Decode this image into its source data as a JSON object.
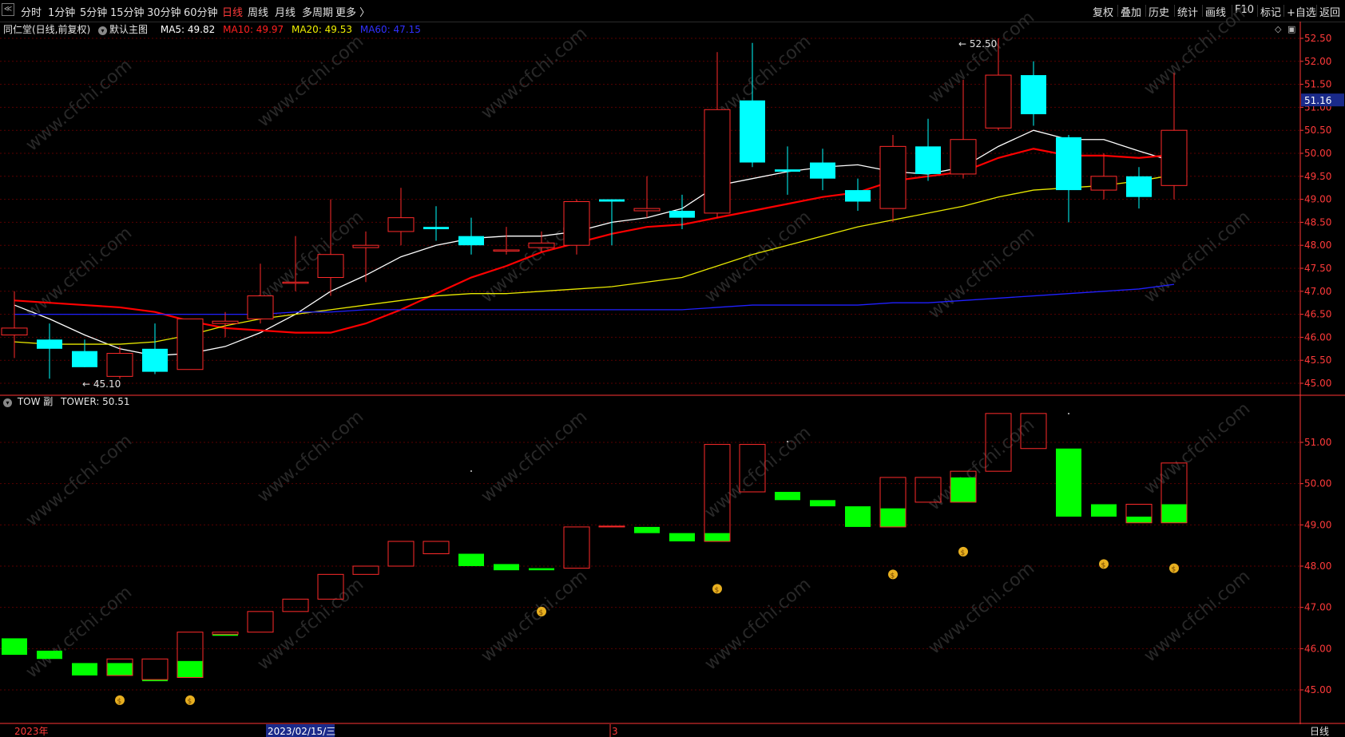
{
  "toolbar": {
    "left_icon": "collapse-icon",
    "periods": [
      "分时",
      "1分钟",
      "5分钟",
      "15分钟",
      "30分钟",
      "60分钟",
      "日线",
      "周线",
      "月线",
      "多周期",
      "更多 〉"
    ],
    "active_period": "日线",
    "right": [
      "复权",
      "叠加",
      "历史",
      "统计",
      "画线",
      "F10",
      "标记",
      "+自选",
      "返回"
    ]
  },
  "main_legend": {
    "stock": "同仁堂(日线,前复权)",
    "template": "默认主图",
    "ma5": "MA5: 49.82",
    "ma10": "MA10: 49.97",
    "ma20": "MA20: 49.53",
    "ma60": "MA60: 47.15"
  },
  "sub_legend": {
    "name": "TOW 副",
    "value": "TOWER: 50.51"
  },
  "annotations": {
    "high": "52.50",
    "low": "45.10",
    "last_price": "51.16"
  },
  "bottom": {
    "year": "2023年",
    "date": "2023/02/15/三",
    "month": "3",
    "period": "日线"
  },
  "watermark": "www.cfchi.com",
  "colors": {
    "up": "#ff2a2a",
    "down": "#00ffff",
    "ma5": "#ffffff",
    "ma10": "#ff0000",
    "ma20": "#e8e800",
    "ma60": "#2020ff",
    "tower_up": "#00ff00",
    "tower_frame": "#ff2a2a",
    "axis": "#ff3333",
    "grid": "#5a0000"
  },
  "chart_data": [
    {
      "type": "candlestick",
      "title": "同仁堂(日线,前复权)",
      "y_ticks": [
        "52.50",
        "52.00",
        "51.50",
        "51.00",
        "50.50",
        "50.00",
        "49.50",
        "49.00",
        "48.50",
        "48.00",
        "47.50",
        "47.00",
        "46.50",
        "46.00",
        "45.50",
        "45.00"
      ],
      "ylim": [
        44.9,
        52.6
      ],
      "candles": [
        {
          "o": 46.05,
          "h": 47.0,
          "l": 45.55,
          "c": 46.2
        },
        {
          "o": 45.95,
          "h": 46.3,
          "l": 45.1,
          "c": 45.75
        },
        {
          "o": 45.7,
          "h": 45.95,
          "l": 45.35,
          "c": 45.35
        },
        {
          "o": 45.15,
          "h": 45.8,
          "l": 45.1,
          "c": 45.65
        },
        {
          "o": 45.75,
          "h": 46.3,
          "l": 45.2,
          "c": 45.25
        },
        {
          "o": 45.3,
          "h": 46.4,
          "l": 45.3,
          "c": 46.4
        },
        {
          "o": 46.3,
          "h": 46.55,
          "l": 46.0,
          "c": 46.35
        },
        {
          "o": 46.4,
          "h": 47.6,
          "l": 46.3,
          "c": 46.9
        },
        {
          "o": 47.2,
          "h": 48.2,
          "l": 47.0,
          "c": 47.2
        },
        {
          "o": 47.3,
          "h": 49.0,
          "l": 46.9,
          "c": 47.8
        },
        {
          "o": 47.95,
          "h": 48.3,
          "l": 47.2,
          "c": 48.0
        },
        {
          "o": 48.3,
          "h": 49.25,
          "l": 48.0,
          "c": 48.6
        },
        {
          "o": 48.4,
          "h": 48.85,
          "l": 48.1,
          "c": 48.35
        },
        {
          "o": 48.2,
          "h": 48.6,
          "l": 47.8,
          "c": 48.0
        },
        {
          "o": 47.9,
          "h": 48.4,
          "l": 47.8,
          "c": 47.9
        },
        {
          "o": 47.95,
          "h": 48.3,
          "l": 47.85,
          "c": 48.05
        },
        {
          "o": 48.0,
          "h": 49.0,
          "l": 47.8,
          "c": 48.95
        },
        {
          "o": 49.0,
          "h": 49.0,
          "l": 48.0,
          "c": 48.95
        },
        {
          "o": 48.75,
          "h": 49.5,
          "l": 48.6,
          "c": 48.8
        },
        {
          "o": 48.75,
          "h": 49.1,
          "l": 48.35,
          "c": 48.6
        },
        {
          "o": 48.7,
          "h": 52.2,
          "l": 48.6,
          "c": 50.95
        },
        {
          "o": 51.15,
          "h": 52.4,
          "l": 49.7,
          "c": 49.8
        },
        {
          "o": 49.65,
          "h": 50.15,
          "l": 49.1,
          "c": 49.6
        },
        {
          "o": 49.8,
          "h": 50.1,
          "l": 49.2,
          "c": 49.45
        },
        {
          "o": 49.2,
          "h": 49.45,
          "l": 48.75,
          "c": 48.95
        },
        {
          "o": 48.8,
          "h": 50.4,
          "l": 48.5,
          "c": 50.15
        },
        {
          "o": 50.15,
          "h": 50.75,
          "l": 49.4,
          "c": 49.55
        },
        {
          "o": 49.55,
          "h": 51.6,
          "l": 49.45,
          "c": 50.3
        },
        {
          "o": 50.55,
          "h": 52.5,
          "l": 50.5,
          "c": 51.7
        },
        {
          "o": 51.7,
          "h": 52.0,
          "l": 50.6,
          "c": 50.85
        },
        {
          "o": 50.35,
          "h": 50.4,
          "l": 48.5,
          "c": 49.2
        },
        {
          "o": 49.2,
          "h": 50.0,
          "l": 49.0,
          "c": 49.5
        },
        {
          "o": 49.5,
          "h": 49.7,
          "l": 48.8,
          "c": 49.05
        },
        {
          "o": 49.3,
          "h": 51.75,
          "l": 49.0,
          "c": 50.5
        }
      ],
      "series": [
        {
          "name": "MA5",
          "values": [
            46.7,
            46.4,
            46.05,
            45.75,
            45.6,
            45.65,
            45.8,
            46.1,
            46.5,
            47.0,
            47.35,
            47.75,
            48.0,
            48.15,
            48.2,
            48.2,
            48.3,
            48.5,
            48.6,
            48.8,
            49.3,
            49.45,
            49.6,
            49.7,
            49.75,
            49.6,
            49.55,
            49.7,
            50.15,
            50.5,
            50.3,
            50.3,
            50.05,
            49.82
          ]
        },
        {
          "name": "MA10",
          "values": [
            46.8,
            46.75,
            46.7,
            46.65,
            46.55,
            46.35,
            46.2,
            46.15,
            46.1,
            46.1,
            46.3,
            46.6,
            46.95,
            47.3,
            47.55,
            47.85,
            48.05,
            48.25,
            48.4,
            48.45,
            48.6,
            48.75,
            48.9,
            49.05,
            49.15,
            49.4,
            49.5,
            49.6,
            49.9,
            50.1,
            49.95,
            49.95,
            49.9,
            49.97
          ]
        },
        {
          "name": "MA20",
          "values": [
            45.9,
            45.85,
            45.85,
            45.85,
            45.9,
            46.05,
            46.25,
            46.4,
            46.5,
            46.6,
            46.7,
            46.8,
            46.9,
            46.95,
            46.95,
            47.0,
            47.05,
            47.1,
            47.2,
            47.3,
            47.55,
            47.8,
            48.0,
            48.2,
            48.4,
            48.55,
            48.7,
            48.85,
            49.05,
            49.2,
            49.25,
            49.3,
            49.4,
            49.53
          ]
        },
        {
          "name": "MA60",
          "values": [
            46.5,
            46.5,
            46.5,
            46.5,
            46.5,
            46.5,
            46.5,
            46.5,
            46.55,
            46.55,
            46.6,
            46.6,
            46.6,
            46.6,
            46.6,
            46.6,
            46.6,
            46.6,
            46.6,
            46.6,
            46.65,
            46.7,
            46.7,
            46.7,
            46.7,
            46.75,
            46.75,
            46.8,
            46.85,
            46.9,
            46.95,
            47.0,
            47.05,
            47.15
          ]
        }
      ]
    },
    {
      "type": "bar",
      "title": "TOW 副 TOWER",
      "y_ticks": [
        "51.00",
        "50.00",
        "49.00",
        "48.00",
        "47.00",
        "46.00",
        "45.00"
      ],
      "ylim": [
        44.6,
        51.9
      ],
      "towers": [
        {
          "lo": 45.85,
          "hi": 46.25,
          "frame_lo": null,
          "frame_hi": null,
          "fill": "green"
        },
        {
          "lo": 45.75,
          "hi": 45.95,
          "frame_lo": null,
          "frame_hi": null,
          "fill": "green"
        },
        {
          "lo": 45.35,
          "hi": 45.65,
          "frame_lo": null,
          "frame_hi": null,
          "fill": "green"
        },
        {
          "lo": 45.35,
          "hi": 45.65,
          "frame_lo": 45.35,
          "frame_hi": 45.75,
          "fill": "green"
        },
        {
          "lo": 45.25,
          "hi": 45.25,
          "frame_lo": 45.25,
          "frame_hi": 45.75,
          "fill": "none"
        },
        {
          "lo": 45.3,
          "hi": 45.7,
          "frame_lo": 45.3,
          "frame_hi": 46.4,
          "fill": "green"
        },
        {
          "lo": 46.35,
          "hi": 46.35,
          "frame_lo": 46.35,
          "frame_hi": 46.4,
          "fill": "none"
        },
        {
          "lo": null,
          "hi": null,
          "frame_lo": 46.4,
          "frame_hi": 46.9,
          "fill": "none"
        },
        {
          "lo": null,
          "hi": null,
          "frame_lo": 46.9,
          "frame_hi": 47.2,
          "fill": "none"
        },
        {
          "lo": null,
          "hi": null,
          "frame_lo": 47.2,
          "frame_hi": 47.8,
          "fill": "none"
        },
        {
          "lo": null,
          "hi": null,
          "frame_lo": 47.8,
          "frame_hi": 48.0,
          "fill": "none"
        },
        {
          "lo": null,
          "hi": null,
          "frame_lo": 48.0,
          "frame_hi": 48.6,
          "fill": "none"
        },
        {
          "lo": null,
          "hi": null,
          "frame_lo": 48.3,
          "frame_hi": 48.6,
          "fill": "none"
        },
        {
          "lo": 48.0,
          "hi": 48.3,
          "frame_lo": null,
          "frame_hi": null,
          "fill": "green"
        },
        {
          "lo": 47.9,
          "hi": 48.05,
          "frame_lo": null,
          "frame_hi": null,
          "fill": "green"
        },
        {
          "lo": 47.9,
          "hi": 47.95,
          "frame_lo": null,
          "frame_hi": null,
          "fill": "green"
        },
        {
          "lo": null,
          "hi": null,
          "frame_lo": 47.95,
          "frame_hi": 48.95,
          "fill": "none"
        },
        {
          "lo": null,
          "hi": null,
          "frame_lo": 48.95,
          "frame_hi": 48.97,
          "fill": "none"
        },
        {
          "lo": 48.8,
          "hi": 48.95,
          "frame_lo": null,
          "frame_hi": null,
          "fill": "green"
        },
        {
          "lo": 48.6,
          "hi": 48.8,
          "frame_lo": null,
          "frame_hi": null,
          "fill": "green"
        },
        {
          "lo": 48.6,
          "hi": 48.8,
          "frame_lo": 48.6,
          "frame_hi": 50.95,
          "fill": "green"
        },
        {
          "lo": null,
          "hi": null,
          "frame_lo": 49.8,
          "frame_hi": 50.95,
          "fill": "none"
        },
        {
          "lo": 49.6,
          "hi": 49.8,
          "frame_lo": null,
          "frame_hi": null,
          "fill": "green"
        },
        {
          "lo": 49.45,
          "hi": 49.6,
          "frame_lo": null,
          "frame_hi": null,
          "fill": "green"
        },
        {
          "lo": 48.95,
          "hi": 49.45,
          "frame_lo": null,
          "frame_hi": null,
          "fill": "green"
        },
        {
          "lo": 48.95,
          "hi": 49.4,
          "frame_lo": 48.95,
          "frame_hi": 50.15,
          "fill": "green"
        },
        {
          "lo": null,
          "hi": null,
          "frame_lo": 49.55,
          "frame_hi": 50.15,
          "fill": "none"
        },
        {
          "lo": 49.55,
          "hi": 50.15,
          "frame_lo": 49.55,
          "frame_hi": 50.3,
          "fill": "green"
        },
        {
          "lo": null,
          "hi": null,
          "frame_lo": 50.3,
          "frame_hi": 51.7,
          "fill": "none"
        },
        {
          "lo": null,
          "hi": null,
          "frame_lo": 50.85,
          "frame_hi": 51.7,
          "fill": "none"
        },
        {
          "lo": 49.2,
          "hi": 50.85,
          "frame_lo": null,
          "frame_hi": null,
          "fill": "green"
        },
        {
          "lo": 49.2,
          "hi": 49.5,
          "frame_lo": null,
          "frame_hi": null,
          "fill": "green"
        },
        {
          "lo": 49.05,
          "hi": 49.2,
          "frame_lo": 49.05,
          "frame_hi": 49.5,
          "fill": "green"
        },
        {
          "lo": 49.05,
          "hi": 49.5,
          "frame_lo": 49.05,
          "frame_hi": 50.5,
          "fill": "green"
        }
      ],
      "signals": [
        {
          "i": 3,
          "v": 44.75
        },
        {
          "i": 5,
          "v": 44.75
        },
        {
          "i": 15,
          "v": 46.9
        },
        {
          "i": 20,
          "v": 47.45
        },
        {
          "i": 25,
          "v": 47.8
        },
        {
          "i": 27,
          "v": 48.35
        },
        {
          "i": 31,
          "v": 48.05
        },
        {
          "i": 33,
          "v": 47.95
        }
      ]
    }
  ]
}
